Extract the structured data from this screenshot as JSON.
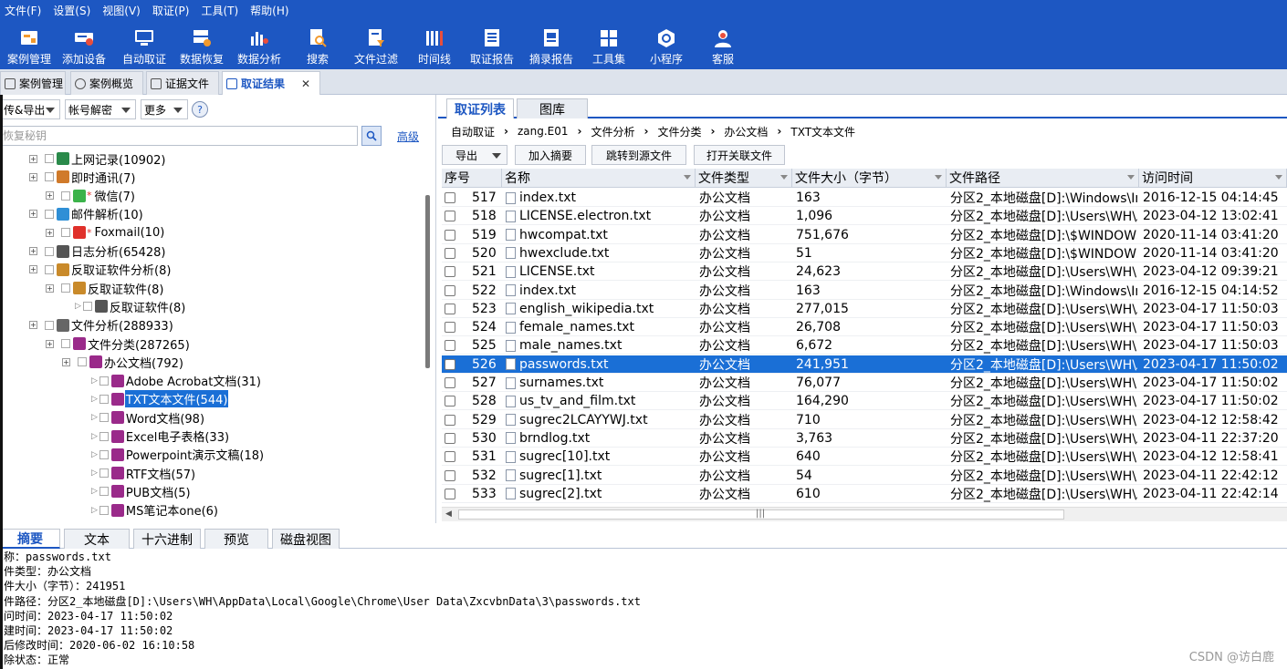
{
  "menu": [
    "文件(F)",
    "设置(S)",
    "视图(V)",
    "取证(P)",
    "工具(T)",
    "帮助(H)"
  ],
  "toolbar": [
    {
      "label": "案例管理",
      "icon": "case-management-icon"
    },
    {
      "label": "添加设备",
      "icon": "add-device-icon"
    },
    {
      "label": "自动取证",
      "icon": "auto-forensics-icon"
    },
    {
      "label": "数据恢复",
      "icon": "data-recovery-icon"
    },
    {
      "label": "数据分析",
      "icon": "data-analysis-icon"
    },
    {
      "label": "搜索",
      "icon": "search-icon"
    },
    {
      "label": "文件过滤",
      "icon": "file-filter-icon"
    },
    {
      "label": "时间线",
      "icon": "timeline-icon"
    },
    {
      "label": "取证报告",
      "icon": "forensics-report-icon"
    },
    {
      "label": "摘录报告",
      "icon": "excerpt-report-icon"
    },
    {
      "label": "工具集",
      "icon": "toolset-icon"
    },
    {
      "label": "小程序",
      "icon": "mini-program-icon"
    },
    {
      "label": "客服",
      "icon": "customer-service-icon"
    }
  ],
  "tabs": [
    "案例管理",
    "案例概览",
    "证据文件",
    "取证结果"
  ],
  "left": {
    "btn_transfer": "传&导出",
    "btn_account": "帐号解密",
    "btn_more": "更多",
    "help": "?",
    "search_placeholder": "恢复秘钥",
    "advanced": "高级",
    "tree": [
      {
        "label": "上网记录(10902)"
      },
      {
        "label": "即时通讯(7)"
      },
      {
        "label": "微信(7)"
      },
      {
        "label": "邮件解析(10)"
      },
      {
        "label": "Foxmail(10)"
      },
      {
        "label": "日志分析(65428)"
      },
      {
        "label": "反取证软件分析(8)"
      },
      {
        "label": "反取证软件(8)"
      },
      {
        "label": "反取证软件(8)"
      },
      {
        "label": "文件分析(288933)"
      },
      {
        "label": "文件分类(287265)"
      },
      {
        "label": "办公文档(792)"
      },
      {
        "label": "Adobe Acrobat文档(31)"
      },
      {
        "label": "TXT文本文件(544)"
      },
      {
        "label": "Word文档(98)"
      },
      {
        "label": "Excel电子表格(33)"
      },
      {
        "label": "Powerpoint演示文稿(18)"
      },
      {
        "label": "RTF文档(57)"
      },
      {
        "label": "PUB文档(5)"
      },
      {
        "label": "MS笔记本one(6)"
      }
    ]
  },
  "right": {
    "tab_list": "取证列表",
    "tab_gallery": "图库",
    "breadcrumb": [
      "自动取证",
      "zang.E01",
      "文件分析",
      "文件分类",
      "办公文档",
      "TXT文本文件"
    ],
    "btn_export": "导出",
    "btn_add_excerpt": "加入摘要",
    "btn_jump": "跳转到源文件",
    "btn_open": "打开关联文件",
    "columns": [
      "序号",
      "名称",
      "文件类型",
      "文件大小（字节）",
      "文件路径",
      "访问时间"
    ],
    "rows": [
      {
        "no": "517",
        "name": "index.txt",
        "type": "办公文档",
        "size": "163",
        "path": "分区2_本地磁盘[D]:\\Windows\\Inf...",
        "time": "2016-12-15 04:14:45"
      },
      {
        "no": "518",
        "name": "LICENSE.electron.txt",
        "type": "办公文档",
        "size": "1,096",
        "path": "分区2_本地磁盘[D]:\\Users\\WH\\A...",
        "time": "2023-04-12 13:02:41"
      },
      {
        "no": "519",
        "name": "hwcompat.txt",
        "type": "办公文档",
        "size": "751,676",
        "path": "分区2_本地磁盘[D]:\\$WINDOWS....",
        "time": "2020-11-14 03:41:20"
      },
      {
        "no": "520",
        "name": "hwexclude.txt",
        "type": "办公文档",
        "size": "51",
        "path": "分区2_本地磁盘[D]:\\$WINDOWS....",
        "time": "2020-11-14 03:41:20"
      },
      {
        "no": "521",
        "name": "LICENSE.txt",
        "type": "办公文档",
        "size": "24,623",
        "path": "分区2_本地磁盘[D]:\\Users\\WH\\...",
        "time": "2023-04-12 09:39:21"
      },
      {
        "no": "522",
        "name": "index.txt",
        "type": "办公文档",
        "size": "163",
        "path": "分区2_本地磁盘[D]:\\Windows\\In...",
        "time": "2016-12-15 04:14:52"
      },
      {
        "no": "523",
        "name": "english_wikipedia.txt",
        "type": "办公文档",
        "size": "277,015",
        "path": "分区2_本地磁盘[D]:\\Users\\WH\\A...",
        "time": "2023-04-17 11:50:03"
      },
      {
        "no": "524",
        "name": "female_names.txt",
        "type": "办公文档",
        "size": "26,708",
        "path": "分区2_本地磁盘[D]:\\Users\\WH\\...",
        "time": "2023-04-17 11:50:03"
      },
      {
        "no": "525",
        "name": "male_names.txt",
        "type": "办公文档",
        "size": "6,672",
        "path": "分区2_本地磁盘[D]:\\Users\\WH\\...",
        "time": "2023-04-17 11:50:03"
      },
      {
        "no": "526",
        "name": "passwords.txt",
        "type": "办公文档",
        "size": "241,951",
        "path": "分区2_本地磁盘[D]:\\Users\\WH\\A...",
        "time": "2023-04-17 11:50:02"
      },
      {
        "no": "527",
        "name": "surnames.txt",
        "type": "办公文档",
        "size": "76,077",
        "path": "分区2_本地磁盘[D]:\\Users\\WH\\...",
        "time": "2023-04-17 11:50:02"
      },
      {
        "no": "528",
        "name": "us_tv_and_film.txt",
        "type": "办公文档",
        "size": "164,290",
        "path": "分区2_本地磁盘[D]:\\Users\\WH\\...",
        "time": "2023-04-17 11:50:02"
      },
      {
        "no": "529",
        "name": "sugrec2LCAYYWJ.txt",
        "type": "办公文档",
        "size": "710",
        "path": "分区2_本地磁盘[D]:\\Users\\WH\\...",
        "time": "2023-04-12 12:58:42"
      },
      {
        "no": "530",
        "name": "brndlog.txt",
        "type": "办公文档",
        "size": "3,763",
        "path": "分区2_本地磁盘[D]:\\Users\\WH\\A...",
        "time": "2023-04-11 22:37:20"
      },
      {
        "no": "531",
        "name": "sugrec[10].txt",
        "type": "办公文档",
        "size": "640",
        "path": "分区2_本地磁盘[D]:\\Users\\WH\\...",
        "time": "2023-04-12 12:58:41"
      },
      {
        "no": "532",
        "name": "sugrec[1].txt",
        "type": "办公文档",
        "size": "54",
        "path": "分区2_本地磁盘[D]:\\Users\\WH\\...",
        "time": "2023-04-11 22:42:12"
      },
      {
        "no": "533",
        "name": "sugrec[2].txt",
        "type": "办公文档",
        "size": "610",
        "path": "分区2_本地磁盘[D]:\\Users\\WH\\A...",
        "time": "2023-04-11 22:42:14"
      }
    ]
  },
  "bottom": {
    "tabs": [
      "摘要",
      "文本",
      "十六进制",
      "预览",
      "磁盘视图"
    ],
    "lines": [
      "称：passwords.txt",
      "件类型：办公文档",
      "件大小（字节）：241951",
      "件路径：分区2_本地磁盘[D]:\\Users\\WH\\AppData\\Local\\Google\\Chrome\\User Data\\ZxcvbnData\\3\\passwords.txt",
      "问时间：2023-04-17 11:50:02",
      "建时间：2023-04-17 11:50:02",
      "后修改时间：2020-06-02 16:10:58",
      "除状态：正常"
    ]
  },
  "watermark": "CSDN @访白鹿",
  "colors": {
    "brand": "#1d57c2",
    "selection": "#1a6fd6"
  }
}
